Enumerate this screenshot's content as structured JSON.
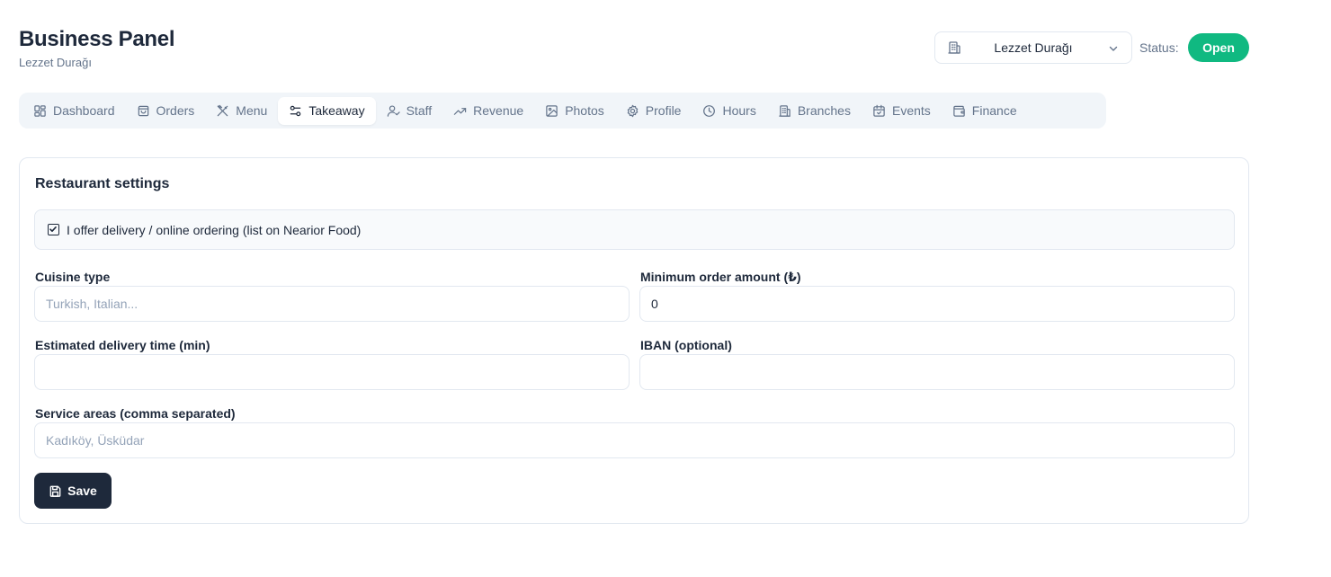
{
  "header": {
    "title": "Business Panel",
    "subtitle": "Lezzet Durağı"
  },
  "branch_select": {
    "selected": "Lezzet Durağı",
    "icon": "building-icon"
  },
  "status": {
    "label": "Status:",
    "value": "Open",
    "color": "#10b981"
  },
  "tabs": [
    {
      "label": "Dashboard",
      "icon": "dashboard-icon",
      "active": false
    },
    {
      "label": "Orders",
      "icon": "bag-icon",
      "active": false
    },
    {
      "label": "Menu",
      "icon": "utensils-icon",
      "active": false
    },
    {
      "label": "Takeaway",
      "icon": "sliders-icon",
      "active": true
    },
    {
      "label": "Staff",
      "icon": "user-check-icon",
      "active": false
    },
    {
      "label": "Revenue",
      "icon": "trending-up-icon",
      "active": false
    },
    {
      "label": "Photos",
      "icon": "image-icon",
      "active": false
    },
    {
      "label": "Profile",
      "icon": "gear-icon",
      "active": false
    },
    {
      "label": "Hours",
      "icon": "clock-icon",
      "active": false
    },
    {
      "label": "Branches",
      "icon": "building-icon",
      "active": false
    },
    {
      "label": "Events",
      "icon": "calendar-icon",
      "active": false
    },
    {
      "label": "Finance",
      "icon": "wallet-icon",
      "active": false
    }
  ],
  "settings": {
    "title": "Restaurant settings",
    "delivery_checkbox": {
      "label": "I offer delivery / online ordering (list on Nearior Food)",
      "checked": true
    },
    "cuisine": {
      "label": "Cuisine type",
      "value": "",
      "placeholder": "Turkish, Italian..."
    },
    "min_order": {
      "label": "Minimum order amount (₺)",
      "value": "0",
      "placeholder": ""
    },
    "delivery_time": {
      "label": "Estimated delivery time (min)",
      "value": "",
      "placeholder": ""
    },
    "iban": {
      "label": "IBAN (optional)",
      "value": "",
      "placeholder": ""
    },
    "service_areas": {
      "label": "Service areas (comma separated)",
      "value": "",
      "placeholder": "Kadıköy, Üsküdar"
    },
    "save_label": "Save"
  },
  "colors": {
    "primary_dark": "#1e293b",
    "muted_text": "#64748b",
    "border": "#e2e8f0",
    "tab_bar_bg": "#f1f5f9",
    "success": "#10b981"
  }
}
